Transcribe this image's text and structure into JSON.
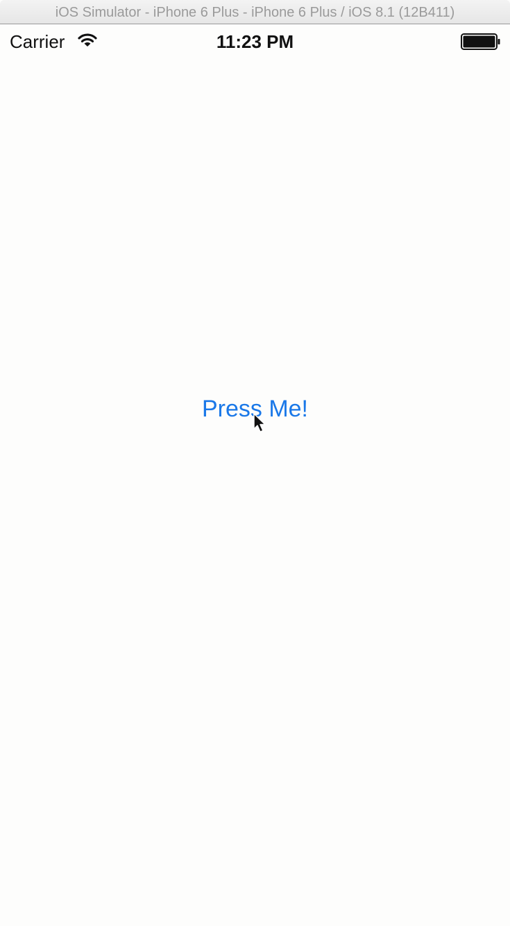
{
  "window": {
    "title": "iOS Simulator - iPhone 6 Plus - iPhone 6 Plus / iOS 8.1 (12B411)"
  },
  "status_bar": {
    "carrier": "Carrier",
    "time": "11:23 PM",
    "icons": [
      "wifi-icon",
      "battery-icon"
    ]
  },
  "main": {
    "button_label": "Press Me!",
    "button_color": "#1a78e8"
  },
  "colors": {
    "background": "#fdfdfc",
    "titlebar_text": "#9a9a9a"
  }
}
